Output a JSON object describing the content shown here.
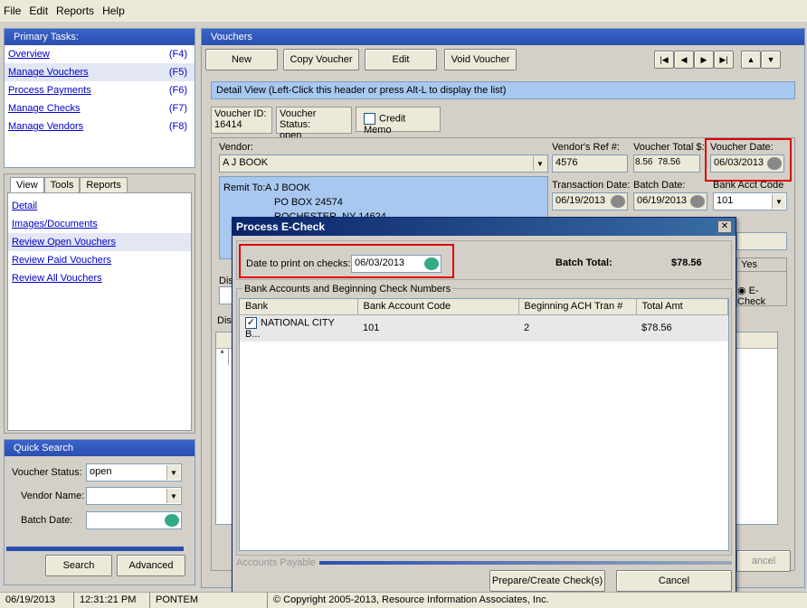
{
  "menu": [
    "File",
    "Edit",
    "Reports",
    "Help"
  ],
  "primary_tasks": {
    "title": "Primary Tasks:",
    "items": [
      {
        "label": "Overview",
        "key": "(F4)"
      },
      {
        "label": "Manage Vouchers",
        "key": "(F5)"
      },
      {
        "label": "Process Payments",
        "key": "(F6)"
      },
      {
        "label": "Manage Checks",
        "key": "(F7)"
      },
      {
        "label": "Manage Vendors",
        "key": "(F8)"
      }
    ]
  },
  "view_tabs": [
    "View",
    "Tools",
    "Reports"
  ],
  "view_items": [
    "Detail",
    "Images/Documents",
    "Review Open Vouchers",
    "Review Paid Vouchers",
    "Review All Vouchers"
  ],
  "quick_search": {
    "title": "Quick Search",
    "voucher_status_label": "Voucher Status:",
    "voucher_status_value": "open",
    "vendor_name_label": "Vendor Name:",
    "batch_date_label": "Batch Date:",
    "search_btn": "Search",
    "advanced_btn": "Advanced"
  },
  "vouchers": {
    "title": "Vouchers",
    "toolbar": [
      "New",
      "Copy Voucher",
      "Edit",
      "Void Voucher"
    ],
    "nav": [
      "|◀",
      "◀",
      "▶",
      "▶|"
    ],
    "updown": [
      "▲",
      "▼"
    ],
    "detail_header": "Detail View  (Left-Click this header or press Alt-L to display the list)",
    "voucher_id_label": "Voucher ID:",
    "voucher_id": "16414",
    "voucher_status_label": "Voucher Status:",
    "voucher_status": "open",
    "credit_memo": "Credit Memo",
    "vendor_label": "Vendor:",
    "vendor": "A J BOOK",
    "ref_label": "Vendor's Ref #:",
    "ref": "4576",
    "total_label": "Voucher Total $:",
    "total": "78.56",
    "total_partial": "8.56",
    "vdate_label": "Voucher Date:",
    "vdate": "06/03/2013",
    "remit_label": "Remit To:",
    "remit_lines": [
      "A J BOOK",
      "PO BOX 24574",
      "ROCHESTER, NY 14624"
    ],
    "trans_date_label": "Transaction Date:",
    "trans_date": "06/19/2013",
    "batch_date_label": "Batch Date:",
    "batch_date": "06/19/2013",
    "bank_acct_label": "Bank Acct Code",
    "bank_acct": "101",
    "yes_label": "Yes",
    "echeck_label": "E-Check",
    "dis_label": "Dis",
    "dis2_label": "Dis",
    "cancel_partial": "ancel"
  },
  "dialog": {
    "title": "Process E-Check",
    "date_label": "Date to print on checks:",
    "date_value": "06/03/2013",
    "batch_total_label": "Batch Total:",
    "batch_total": "$78.56",
    "group_label": "Bank Accounts and Beginning Check Numbers",
    "columns": [
      "Bank",
      "Bank Account Code",
      "Beginning ACH Tran #",
      "Total Amt"
    ],
    "rows": [
      {
        "bank": "NATIONAL CITY B...",
        "code": "101",
        "tran": "2",
        "amt": "$78.56"
      }
    ],
    "progress_label": "Accounts Payable",
    "prepare_btn": "Prepare/Create Check(s)",
    "cancel_btn": "Cancel"
  },
  "status": {
    "date": "06/19/2013",
    "time": "12:31:21 PM",
    "user": "PONTEM",
    "copyright": "© Copyright 2005-2013, Resource Information Associates, Inc."
  }
}
